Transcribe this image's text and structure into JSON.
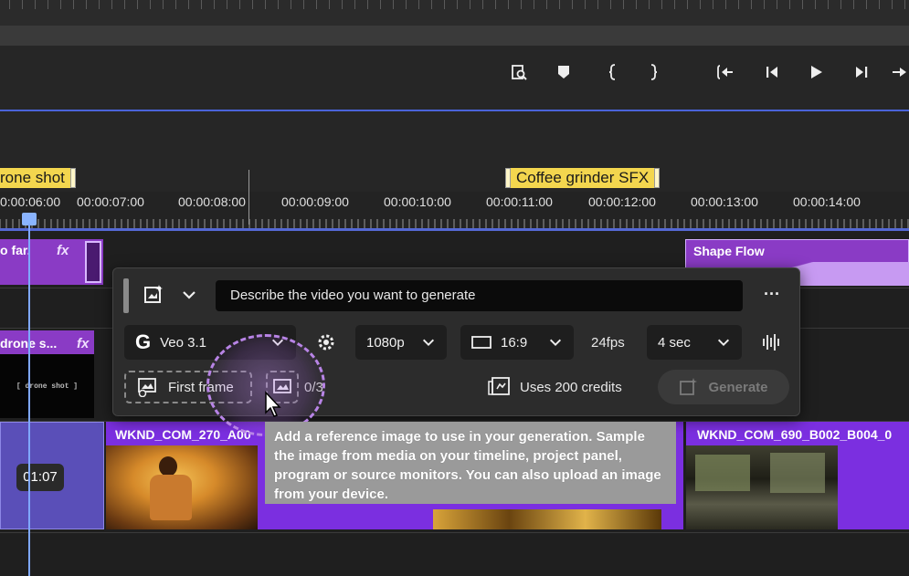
{
  "transport": {
    "icons": [
      "inspect-icon",
      "marker-icon",
      "in-point-icon",
      "out-point-icon",
      "go-to-in-icon",
      "step-back-icon",
      "play-icon",
      "step-forward-icon",
      "go-to-out-icon"
    ]
  },
  "markers": [
    {
      "label": "rone shot"
    },
    {
      "label": "Coffee grinder SFX"
    }
  ],
  "ruler": {
    "timecodes": [
      "0:00:06:00",
      "00:00:07:00",
      "00:00:08:00",
      "00:00:09:00",
      "00:00:10:00",
      "00:00:11:00",
      "00:00:12:00",
      "00:00:13:00",
      "00:00:14:00"
    ]
  },
  "tracks": {
    "v3_left_clip": {
      "label": "o far.",
      "fx": "fx"
    },
    "v3_right_clip": {
      "label": "Shape Flow"
    },
    "v2_left_clip": {
      "label": "drone s...",
      "fx": "fx",
      "thumb_text": "[ drone shot ]"
    },
    "v1_left_clip": {
      "duration": "01:07"
    },
    "v1_mid_clip": {
      "label": "WKND_COM_270_A00"
    },
    "v1_right_clip": {
      "label": "WKND_COM_690_B002_B004_0"
    }
  },
  "popup": {
    "prompt_placeholder": "Describe the video you want to generate",
    "more_label": "···",
    "model": "Veo 3.1",
    "resolution": "1080p",
    "aspect": "16:9",
    "fps": "24fps",
    "duration": "4 sec",
    "first_frame_label": "First frame",
    "ref_count": "0/3",
    "credits": "Uses 200 credits",
    "generate_label": "Generate"
  },
  "tooltip": {
    "text": "Add a reference image to use in your generation. Sample the image from media on your timeline, project panel, program or source monitors. You can also upload an image from your device."
  },
  "colors": {
    "accent_blue": "#4a63d8",
    "marker_yellow": "#f3d64e",
    "clip_purple": "#8a3bc5",
    "clip_violet": "#7b2fe0"
  }
}
